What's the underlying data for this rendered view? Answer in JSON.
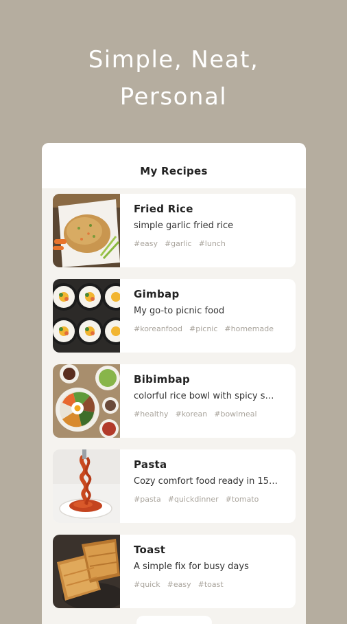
{
  "headline": {
    "line1": "Simple, Neat,",
    "line2": "Personal"
  },
  "app": {
    "title": "My Recipes"
  },
  "recipes": [
    {
      "title": "Fried Rice",
      "description": "simple garlic fried rice",
      "tags": [
        "#easy",
        "#garlic",
        "#lunch"
      ],
      "image": "fried-rice-photo"
    },
    {
      "title": "Gimbap",
      "description": "My go-to picnic food",
      "tags": [
        "#koreanfood",
        "#picnic",
        "#homemade"
      ],
      "image": "gimbap-photo"
    },
    {
      "title": "Bibimbap",
      "description": "colorful rice bowl with spicy s…",
      "tags": [
        "#healthy",
        "#korean",
        "#bowlmeal"
      ],
      "image": "bibimbap-photo"
    },
    {
      "title": "Pasta",
      "description": "Cozy comfort food ready in 15…",
      "tags": [
        "#pasta",
        "#quickdinner",
        "#tomato"
      ],
      "image": "pasta-photo"
    },
    {
      "title": "Toast",
      "description": "A simple fix for busy days",
      "tags": [
        "#quick",
        "#easy",
        "#toast"
      ],
      "image": "toast-photo"
    }
  ],
  "colors": {
    "background": "#b5ad9f",
    "card": "#ffffff",
    "tag": "#a9a49c"
  }
}
